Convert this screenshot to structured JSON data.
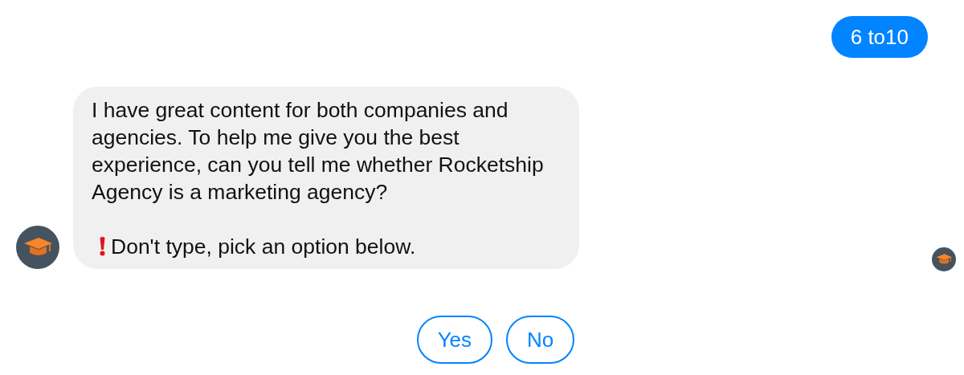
{
  "messages": [
    {
      "kind": "sent",
      "text": "6 to10"
    },
    {
      "kind": "received",
      "paragraphs": [
        {
          "kind": "text",
          "text": "I have great content for both companies and agencies. To help me give you the best experience, can you tell me whether Rocketship Agency is a marketing agency?"
        },
        {
          "kind": "alert",
          "text": "Don't type, pick an option below."
        }
      ],
      "read_receipt": true
    }
  ],
  "quick_replies": [
    "Yes",
    "No"
  ]
}
